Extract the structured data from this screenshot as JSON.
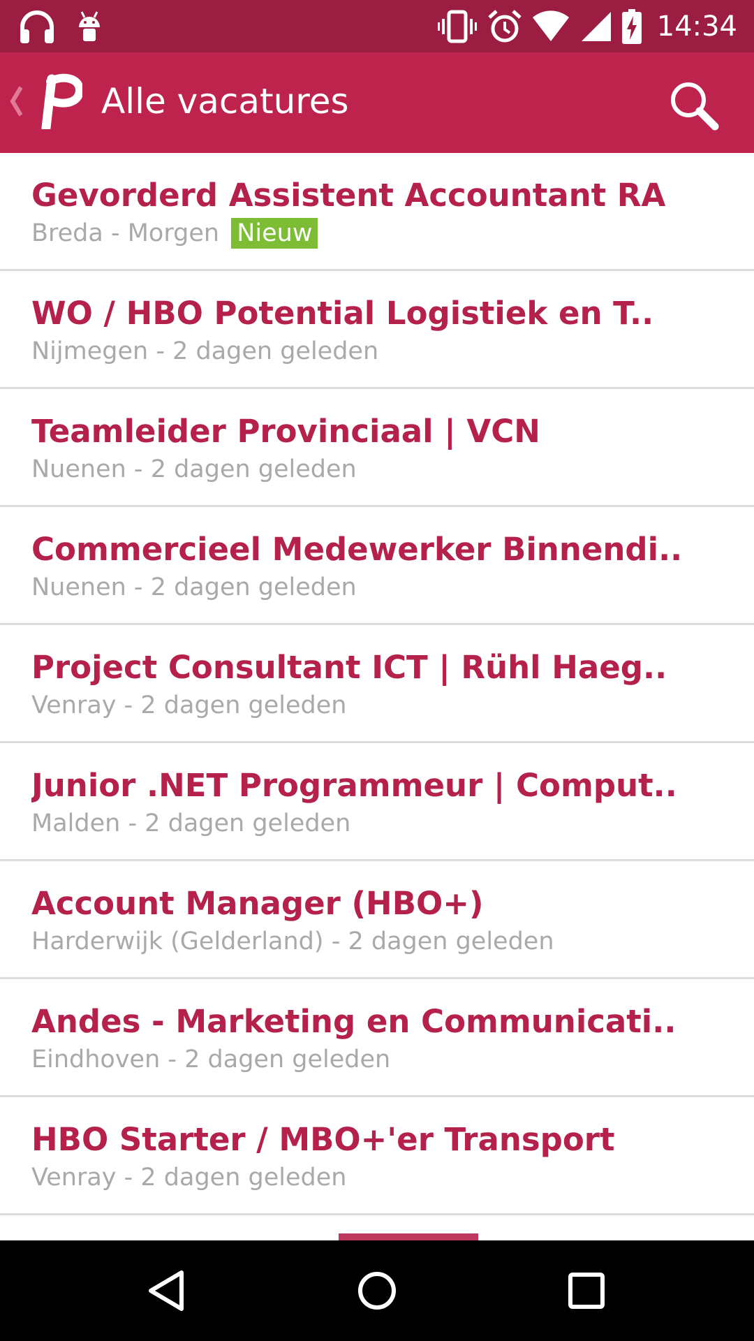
{
  "status_bar": {
    "time": "14:34",
    "icons": [
      "headphones-icon",
      "android-debug-icon",
      "vibrate-icon",
      "alarm-icon",
      "wifi-icon",
      "signal-icon",
      "battery-charging-icon"
    ]
  },
  "app_bar": {
    "title": "Alle vacatures",
    "logo_letter": "P",
    "back_icon": "chevron-left-icon",
    "search_icon": "search-icon"
  },
  "jobs": [
    {
      "title": "Gevorderd Assistent Accountant RA",
      "location": "Breda",
      "time": "Morgen",
      "badge": "Nieuw"
    },
    {
      "title": "WO / HBO Potential Logistiek en T..",
      "location": "Nijmegen",
      "time": "2 dagen geleden"
    },
    {
      "title": "Teamleider Provinciaal | VCN",
      "location": "Nuenen",
      "time": "2 dagen geleden"
    },
    {
      "title": "Commercieel Medewerker Binnendi..",
      "location": "Nuenen",
      "time": "2 dagen geleden"
    },
    {
      "title": "Project Consultant ICT | Rühl Haeg..",
      "location": "Venray",
      "time": "2 dagen geleden"
    },
    {
      "title": "Junior .NET Programmeur | Comput..",
      "location": "Malden",
      "time": "2 dagen geleden"
    },
    {
      "title": "Account Manager (HBO+)",
      "location": "Harderwijk (Gelderland)",
      "time": "2 dagen geleden"
    },
    {
      "title": "Andes - Marketing en Communicati..",
      "location": "Eindhoven",
      "time": "2 dagen geleden"
    },
    {
      "title": "HBO Starter / MBO+'er Transport",
      "location": "Venray",
      "time": "2 dagen geleden"
    }
  ],
  "meta_separator": " - ",
  "nav_bar": {
    "icons": [
      "back-triangle-icon",
      "home-circle-icon",
      "recents-square-icon"
    ]
  },
  "colors": {
    "status_bar": "#9b1d42",
    "app_bar": "#be234d",
    "title_text": "#b4214b",
    "meta_text": "#a9a9a9",
    "badge_new": "#7cbd35",
    "nav_bar": "#000000"
  }
}
